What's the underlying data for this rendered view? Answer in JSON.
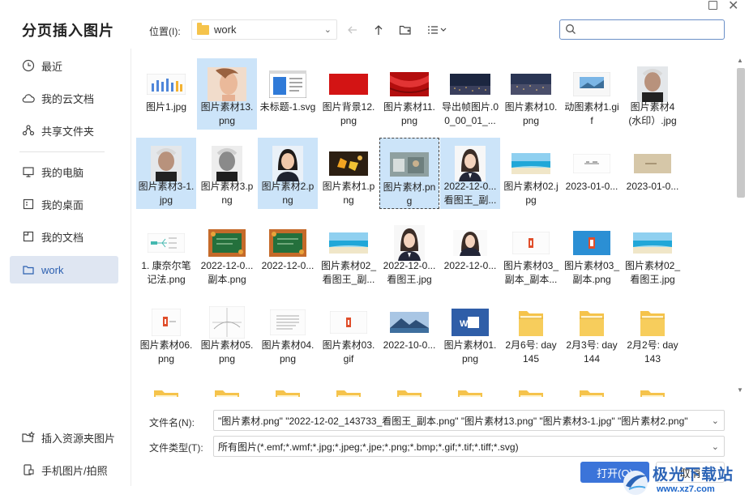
{
  "dialog": {
    "title": "分页插入图片"
  },
  "sidebar": {
    "items": [
      {
        "label": "最近",
        "icon": "clock-icon"
      },
      {
        "label": "我的云文档",
        "icon": "cloud-icon"
      },
      {
        "label": "共享文件夹",
        "icon": "share-icon"
      },
      {
        "label": "我的电脑",
        "icon": "monitor-icon"
      },
      {
        "label": "我的桌面",
        "icon": "desktop-icon"
      },
      {
        "label": "我的文档",
        "icon": "document-icon"
      },
      {
        "label": "work",
        "icon": "folder-icon",
        "active": true
      }
    ],
    "bottom": [
      {
        "label": "插入资源夹图片",
        "icon": "resource-folder-icon"
      },
      {
        "label": "手机图片/拍照",
        "icon": "phone-icon"
      }
    ]
  },
  "toolbar": {
    "location_label": "位置(I):",
    "location_value": "work",
    "search_placeholder": ""
  },
  "files": [
    {
      "name": "图片1.jpg",
      "thumb": "chart",
      "selected": false
    },
    {
      "name": "图片素材13.png",
      "thumb": "face-woman",
      "selected": true
    },
    {
      "name": "未标题-1.svg",
      "thumb": "window",
      "selected": false
    },
    {
      "name": "图片背景12.png",
      "thumb": "red",
      "selected": false
    },
    {
      "name": "图片素材11.png",
      "thumb": "red-curtain",
      "selected": false
    },
    {
      "name": "导出帧图片.00_00_01_...",
      "thumb": "night-city",
      "selected": false
    },
    {
      "name": "图片素材10.png",
      "thumb": "night-city2",
      "selected": false
    },
    {
      "name": "动图素材1.gif",
      "thumb": "doc-landscape",
      "selected": false
    },
    {
      "name": "图片素材4(水印）.jpg",
      "thumb": "face-man",
      "selected": false
    },
    {
      "name": "图片素材3-1.jpg",
      "thumb": "face-man",
      "selected": true
    },
    {
      "name": "图片素材3.png",
      "thumb": "face-man-gray",
      "selected": false
    },
    {
      "name": "图片素材2.png",
      "thumb": "face-woman2",
      "selected": true
    },
    {
      "name": "图片素材1.png",
      "thumb": "autumn",
      "selected": false
    },
    {
      "name": "图片素材.png",
      "thumb": "room",
      "selected": true,
      "focused": true
    },
    {
      "name": "2022-12-0...看图王_副...",
      "thumb": "face-girl",
      "selected": true
    },
    {
      "name": "图片素材02.jpg",
      "thumb": "beach",
      "selected": false
    },
    {
      "name": "2023-01-0...",
      "thumb": "doc-text",
      "selected": false
    },
    {
      "name": "2023-01-0...",
      "thumb": "doc-brown",
      "selected": false
    },
    {
      "name": "1. 康奈尔笔记法.png",
      "thumb": "doc-mind",
      "selected": false
    },
    {
      "name": "2022-12-0...副本.png",
      "thumb": "blackboard",
      "selected": false
    },
    {
      "name": "2022-12-0...",
      "thumb": "blackboard",
      "selected": false
    },
    {
      "name": "图片素材02_看图王_副...",
      "thumb": "beach",
      "selected": false
    },
    {
      "name": "2022-12-0...看图王.jpg",
      "thumb": "face-girl",
      "selected": false
    },
    {
      "name": "2022-12-0...",
      "thumb": "face-girl2",
      "selected": false
    },
    {
      "name": "图片素材03_副本_副本...",
      "thumb": "doc-office",
      "selected": false
    },
    {
      "name": "图片素材03_副本.png",
      "thumb": "blue-office",
      "selected": false
    },
    {
      "name": "图片素材02_看图王.jpg",
      "thumb": "beach",
      "selected": false
    },
    {
      "name": "图片素材06.png",
      "thumb": "doc-office2",
      "selected": false
    },
    {
      "name": "图片素材05.png",
      "thumb": "doc-grid",
      "selected": false
    },
    {
      "name": "图片素材04.png",
      "thumb": "doc-lines",
      "selected": false
    },
    {
      "name": "图片素材03.gif",
      "thumb": "doc-office",
      "selected": false
    },
    {
      "name": "2022-10-0...",
      "thumb": "mountain",
      "selected": false
    },
    {
      "name": "图片素材01.png",
      "thumb": "word",
      "selected": false
    },
    {
      "name": "2月6号: day145",
      "thumb": "folder",
      "selected": false
    },
    {
      "name": "2月3号: day144",
      "thumb": "folder",
      "selected": false
    },
    {
      "name": "2月2号: day143",
      "thumb": "folder",
      "selected": false
    },
    {
      "name": "",
      "thumb": "folder",
      "selected": false
    },
    {
      "name": "",
      "thumb": "folder",
      "selected": false
    },
    {
      "name": "",
      "thumb": "folder",
      "selected": false
    },
    {
      "name": "",
      "thumb": "folder",
      "selected": false
    },
    {
      "name": "",
      "thumb": "folder",
      "selected": false
    },
    {
      "name": "",
      "thumb": "folder",
      "selected": false
    },
    {
      "name": "",
      "thumb": "folder",
      "selected": false
    },
    {
      "name": "",
      "thumb": "folder",
      "selected": false
    },
    {
      "name": "",
      "thumb": "folder",
      "selected": false
    }
  ],
  "footer": {
    "filename_label": "文件名(N):",
    "filename_value": "\"图片素材.png\" \"2022-12-02_143733_看图王_副本.png\" \"图片素材13.png\" \"图片素材3-1.jpg\" \"图片素材2.png\"",
    "filetype_label": "文件类型(T):",
    "filetype_value": "所有图片(*.emf;*.wmf;*.jpg;*.jpeg;*.jpe;*.png;*.bmp;*.gif;*.tif;*.tiff;*.svg)",
    "open_label": "打开(O)",
    "cancel_label": "取消"
  },
  "watermark": {
    "text": "极光下载站",
    "url": "www.xz7.com"
  },
  "colors": {
    "accent": "#3b74d9",
    "selection": "#cce4f9",
    "folder": "#f5c34b"
  }
}
